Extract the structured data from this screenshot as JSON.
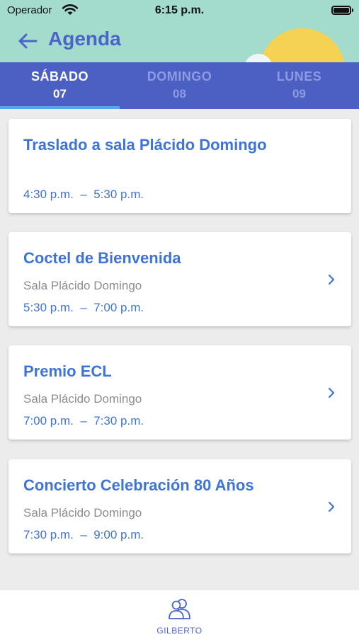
{
  "status_bar": {
    "carrier": "Operador",
    "time": "6:15 p.m.",
    "wifi_icon": "wifi-icon",
    "battery_icon": "battery-icon"
  },
  "header": {
    "title": "Agenda",
    "back_icon": "arrow-left-icon"
  },
  "tabs": [
    {
      "day": "SÁBADO",
      "num": "07",
      "active": true
    },
    {
      "day": "DOMINGO",
      "num": "08",
      "active": false
    },
    {
      "day": "LUNES",
      "num": "09",
      "active": false
    }
  ],
  "events": [
    {
      "title": "Traslado a sala Plácido Domingo",
      "location": "",
      "time": "4:30 p.m.  –  5:30 p.m.",
      "has_detail": false
    },
    {
      "title": "Coctel de Bienvenida",
      "location": "Sala Plácido Domingo",
      "time": "5:30 p.m.  –  7:00 p.m.",
      "has_detail": true
    },
    {
      "title": "Premio ECL",
      "location": "Sala Plácido Domingo",
      "time": "7:00 p.m.  –  7:30 p.m.",
      "has_detail": true
    },
    {
      "title": "Concierto Celebración 80 Años",
      "location": "Sala Plácido Domingo",
      "time": "7:30 p.m.  –  9:00 p.m.",
      "has_detail": true
    }
  ],
  "bottom_nav": {
    "label": "GILBERTO",
    "icon": "users-icon"
  },
  "colors": {
    "header_bg": "#a3dccd",
    "tabbar_bg": "#4c5fc2",
    "accent_blue": "#3f74d6",
    "sun": "#f5d254",
    "tab_indicator": "#55a8e3"
  }
}
